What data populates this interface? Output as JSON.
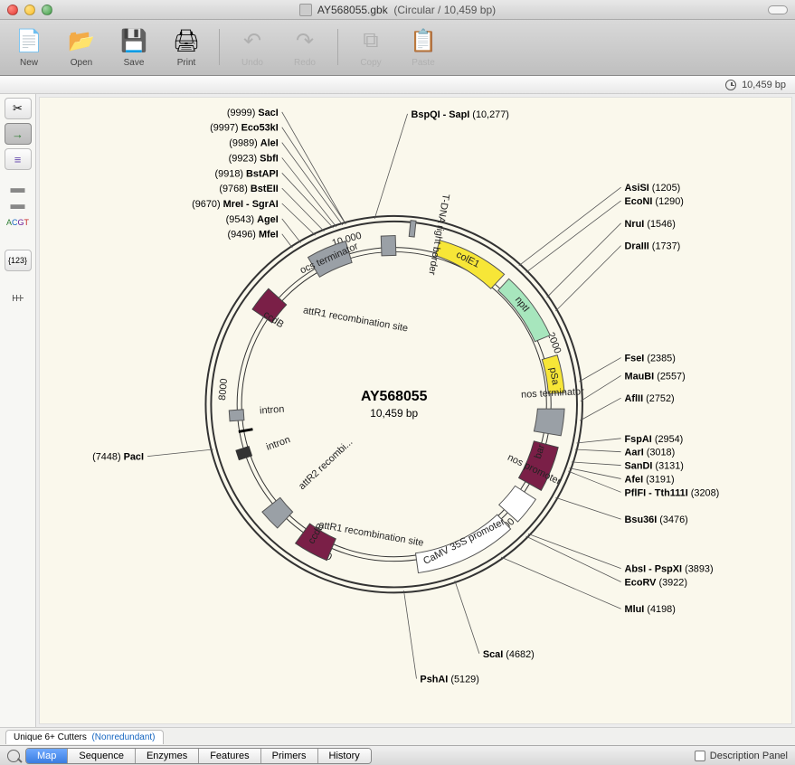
{
  "window": {
    "title_file": "AY568055.gbk",
    "title_topology": "(Circular / 10,459 bp)"
  },
  "toolbar": {
    "new": "New",
    "open": "Open",
    "save": "Save",
    "print": "Print",
    "undo": "Undo",
    "redo": "Redo",
    "copy": "Copy",
    "paste": "Paste"
  },
  "status": {
    "length": "10,459 bp"
  },
  "center": {
    "name": "AY568055",
    "size": "10,459 bp"
  },
  "features": {
    "colE1": "colE1",
    "nptI": "nptI",
    "pSa": "pSa",
    "bar": "bar",
    "nos_term": "nos terminator",
    "nos_prom": "nos promoter",
    "camv": "CaMV 35S promoter",
    "ccdB_cw": "ccdB",
    "ccdB_ccw": "ccdB",
    "attR1_top": "attR1 recombination site",
    "attR1_bot": "attR1 recombination site",
    "attR2": "attR2 recombi...",
    "intron1": "intron",
    "intron2": "intron",
    "ocs": "ocs terminator",
    "tdna": "T-DNA right border"
  },
  "ticks": {
    "two": "2000",
    "four": "4000",
    "six": "6000",
    "eight": "8000",
    "ten": "10,000"
  },
  "enzymes_left": [
    {
      "pos": "(9999)",
      "name": "SacI"
    },
    {
      "pos": "(9997)",
      "name": "Eco53kI"
    },
    {
      "pos": "(9989)",
      "name": "AleI"
    },
    {
      "pos": "(9923)",
      "name": "SbfI"
    },
    {
      "pos": "(9918)",
      "name": "BstAPI"
    },
    {
      "pos": "(9768)",
      "name": "BstEII"
    },
    {
      "pos": "(9670)",
      "name": "MreI - SgrAI"
    },
    {
      "pos": "(9543)",
      "name": "AgeI"
    },
    {
      "pos": "(9496)",
      "name": "MfeI"
    }
  ],
  "enzymes_right": [
    {
      "name": "AsiSI",
      "pos": "(1205)"
    },
    {
      "name": "EcoNI",
      "pos": "(1290)"
    },
    {
      "name": "NruI",
      "pos": "(1546)"
    },
    {
      "name": "DraIII",
      "pos": "(1737)"
    },
    {
      "name": "FseI",
      "pos": "(2385)"
    },
    {
      "name": "MauBI",
      "pos": "(2557)"
    },
    {
      "name": "AflII",
      "pos": "(2752)"
    },
    {
      "name": "FspAI",
      "pos": "(2954)"
    },
    {
      "name": "AarI",
      "pos": "(3018)"
    },
    {
      "name": "SanDI",
      "pos": "(3131)"
    },
    {
      "name": "AfeI",
      "pos": "(3191)"
    },
    {
      "name": "PflFI - Tth111I",
      "pos": "(3208)"
    },
    {
      "name": "Bsu36I",
      "pos": "(3476)"
    },
    {
      "name": "AbsI - PspXI",
      "pos": "(3893)"
    },
    {
      "name": "EcoRV",
      "pos": "(3922)"
    },
    {
      "name": "MluI",
      "pos": "(4198)"
    }
  ],
  "enzymes_top": [
    {
      "name": "BspQI - SapI",
      "pos": "(10,277)"
    }
  ],
  "enzymes_bottom": [
    {
      "name": "ScaI",
      "pos": "(4682)"
    },
    {
      "name": "PshAI",
      "pos": "(5129)"
    }
  ],
  "enzyme_lone_left": {
    "pos": "(7448)",
    "name": "PacI"
  },
  "bottom_tabs": {
    "unique": "Unique 6+ Cutters",
    "nonred": "(Nonredundant)"
  },
  "main_tabs": [
    "Map",
    "Sequence",
    "Enzymes",
    "Features",
    "Primers",
    "History"
  ],
  "desc_panel": "Description Panel"
}
